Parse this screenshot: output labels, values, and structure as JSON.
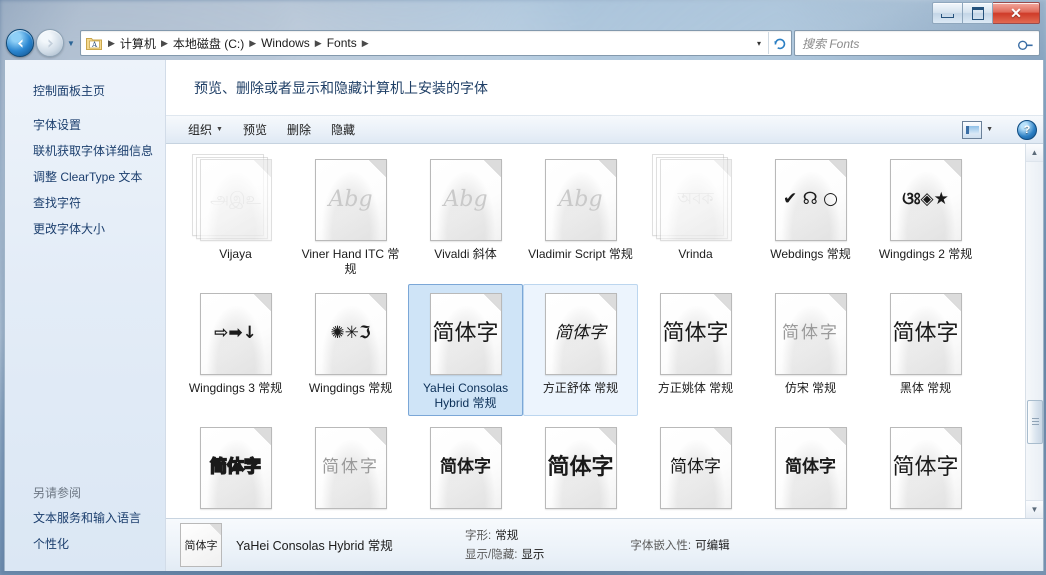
{
  "window": {
    "controls": {
      "minimize": "最小化",
      "maximize": "最大化",
      "close": "关闭"
    }
  },
  "nav": {
    "back": "后退",
    "forward": "前进",
    "recent_pages": "最近浏览的页面",
    "breadcrumbs": [
      "计算机",
      "本地磁盘 (C:)",
      "Windows",
      "Fonts"
    ],
    "address_dropdown": "▾",
    "refresh": "刷新",
    "search_placeholder": "搜索 Fonts",
    "search_value": ""
  },
  "sidebar": {
    "home": "控制面板主页",
    "items": [
      "字体设置",
      "联机获取字体详细信息",
      "调整 ClearType 文本",
      "查找字符",
      "更改字体大小"
    ],
    "see_also_title": "另请参阅",
    "see_also": [
      "文本服务和输入语言",
      "个性化"
    ]
  },
  "page": {
    "header": "预览、删除或者显示和隐藏计算机上安装的字体"
  },
  "toolbar": {
    "organize": "组织",
    "preview": "预览",
    "delete": "删除",
    "hide": "隐藏",
    "view_layout": "更改视图",
    "help": "?"
  },
  "fonts": [
    {
      "label": "Vijaya",
      "sample": "அஇஉ",
      "style": "faint sm",
      "stacked": true,
      "dim": true,
      "state": "normal"
    },
    {
      "label": "Viner Hand ITC 常规",
      "sample": "Abg",
      "style": "faint ital serifish",
      "stacked": false,
      "dim": false,
      "state": "normal"
    },
    {
      "label": "Vivaldi 斜体",
      "sample": "Abg",
      "style": "faint ital serifish",
      "stacked": false,
      "dim": false,
      "state": "normal"
    },
    {
      "label": "Vladimir Script 常规",
      "sample": "Abg",
      "style": "faint ital serifish",
      "stacked": false,
      "dim": false,
      "state": "normal"
    },
    {
      "label": "Vrinda",
      "sample": "অবক",
      "style": "faint sm",
      "stacked": true,
      "dim": true,
      "state": "normal"
    },
    {
      "label": "Webdings 常规",
      "sample": "✔ ☊ ○",
      "style": "sm",
      "stacked": false,
      "dim": false,
      "state": "normal"
    },
    {
      "label": "Wingdings 2 常规",
      "sample": "ଓଃ◈★",
      "style": "sm bold",
      "stacked": false,
      "dim": false,
      "state": "normal"
    },
    {
      "label": "Wingdings 3 常规",
      "sample": "⇨➡↓",
      "style": "sm bold",
      "stacked": false,
      "dim": false,
      "state": "normal"
    },
    {
      "label": "Wingdings 常规",
      "sample": "✺✳ℑ",
      "style": "sm bold",
      "stacked": false,
      "dim": false,
      "state": "normal"
    },
    {
      "label": "YaHei Consolas Hybrid 常规",
      "sample": "简体字",
      "style": "",
      "stacked": false,
      "dim": false,
      "state": "selected"
    },
    {
      "label": "方正舒体 常规",
      "sample": "简体字",
      "style": "sm ital serifish",
      "stacked": false,
      "dim": false,
      "state": "hover"
    },
    {
      "label": "方正姚体 常规",
      "sample": "简体字",
      "style": "serifish",
      "stacked": false,
      "dim": false,
      "state": "normal"
    },
    {
      "label": "仿宋 常规",
      "sample": "简体字",
      "style": "light serifish spaced sm",
      "stacked": false,
      "dim": false,
      "state": "normal"
    },
    {
      "label": "黑体 常规",
      "sample": "简体字",
      "style": "",
      "stacked": false,
      "dim": false,
      "state": "normal"
    },
    {
      "label": "",
      "sample": "简体字",
      "style": "outline sm bold",
      "stacked": false,
      "dim": false,
      "state": "normal"
    },
    {
      "label": "",
      "sample": "简体字",
      "style": "light serifish spaced sm",
      "stacked": false,
      "dim": false,
      "state": "normal"
    },
    {
      "label": "",
      "sample": "简体字",
      "style": "bold serifish sm",
      "stacked": false,
      "dim": false,
      "state": "normal"
    },
    {
      "label": "",
      "sample": "简体字",
      "style": "bold",
      "stacked": false,
      "dim": false,
      "state": "normal"
    },
    {
      "label": "",
      "sample": "简体字",
      "style": "sm",
      "stacked": false,
      "dim": false,
      "state": "normal"
    },
    {
      "label": "",
      "sample": "简体字",
      "style": "bold sm",
      "stacked": false,
      "dim": false,
      "state": "normal"
    },
    {
      "label": "",
      "sample": "简体字",
      "style": "serifish",
      "stacked": false,
      "dim": false,
      "state": "normal"
    }
  ],
  "details": {
    "thumb_sample": "简体字",
    "name": "YaHei Consolas Hybrid 常规",
    "rows": [
      {
        "key": "字形:",
        "value": "常规"
      },
      {
        "key": "显示/隐藏:",
        "value": "显示"
      }
    ],
    "embed_key": "字体嵌入性:",
    "embed_value": "可编辑"
  },
  "scrollbar": {
    "up": "▲",
    "down": "▼"
  }
}
